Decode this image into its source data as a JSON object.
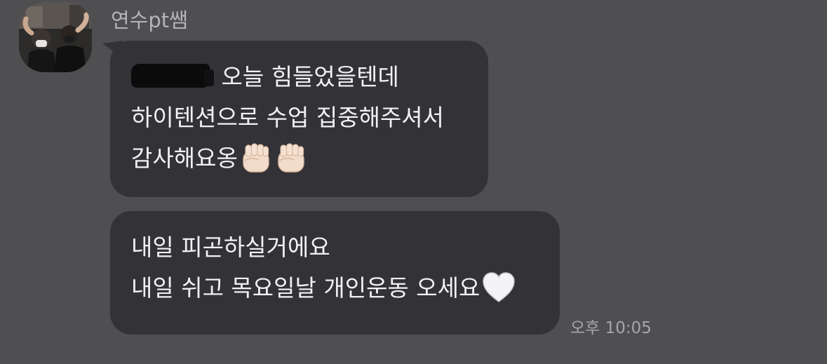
{
  "chat": {
    "sender_name": "연수pt쌤",
    "messages": [
      {
        "lines": [
          {
            "text": " 오늘 힘들었을텐데",
            "redacted_prefix": true
          },
          {
            "text": "하이텐션으로 수업 집중해주셔서"
          },
          {
            "text": "감사해요옹"
          }
        ],
        "emoji": [
          "raised-fist-icon",
          "raised-fist-icon"
        ]
      },
      {
        "lines": [
          {
            "text": "내일 피곤하실거에요"
          },
          {
            "text": "내일 쉬고 목요일날 개인운동 오세요"
          }
        ],
        "emoji": [
          "white-heart-icon"
        ]
      }
    ],
    "timestamp": "오후 10:05"
  },
  "colors": {
    "background": "#4f4e51",
    "bubble": "#333236",
    "text": "#f1f1f3",
    "muted_text": "#a6a5a9"
  }
}
